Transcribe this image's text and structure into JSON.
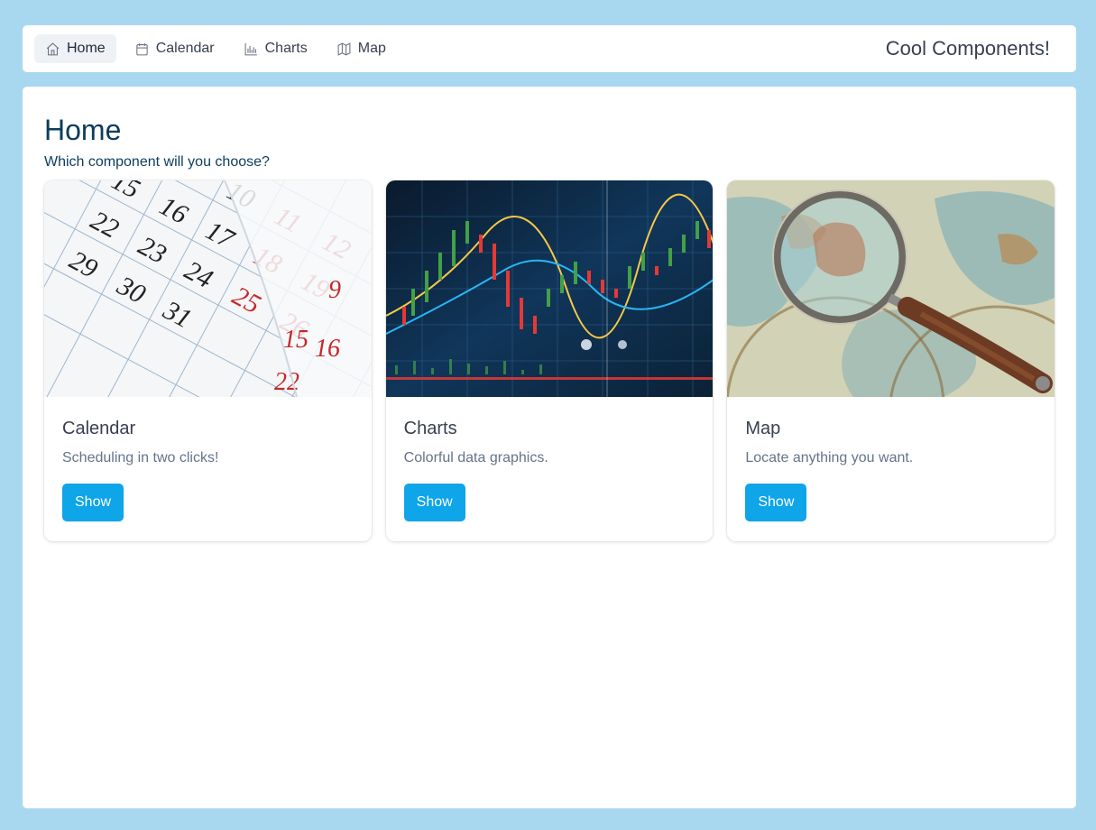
{
  "nav": {
    "items": [
      {
        "label": "Home",
        "icon": "home-icon"
      },
      {
        "label": "Calendar",
        "icon": "calendar-icon"
      },
      {
        "label": "Charts",
        "icon": "bar-chart-icon"
      },
      {
        "label": "Map",
        "icon": "map-icon"
      }
    ],
    "active": "Home",
    "brand": "Cool Components!"
  },
  "main": {
    "title": "Home",
    "subtitle": "Which component will you choose?",
    "cards": [
      {
        "title": "Calendar",
        "text": "Scheduling in two clicks!",
        "button": "Show",
        "image": "calendar-photo"
      },
      {
        "title": "Charts",
        "text": "Colorful data graphics.",
        "button": "Show",
        "image": "stock-chart-photo"
      },
      {
        "title": "Map",
        "text": "Locate anything you want.",
        "button": "Show",
        "image": "antique-map-magnifier-photo"
      }
    ]
  },
  "colors": {
    "background": "#a8d8ef",
    "accent": "#0ea5e9",
    "heading": "#0c3d5c"
  }
}
